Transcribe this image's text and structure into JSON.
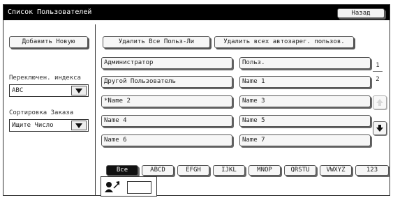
{
  "window": {
    "title": "Список Пользователей",
    "back_label": "Назад"
  },
  "left": {
    "add_new_label": "Добавить Новую",
    "index_switch_label": "Переключен. индекса",
    "index_value": "ABC",
    "sort_label": "Сортировка Заказа",
    "sort_value": "Ищите Число"
  },
  "top_actions": {
    "delete_all_label": "Удалить Все Польз-Ли",
    "delete_auto_label": "Удалить всех автозарег. пользов."
  },
  "users": [
    "Администратор",
    "Польз.",
    "Другой Пользователь",
    "Name 1",
    "*Name 2",
    "Name 3",
    "Name 4",
    "Name 5",
    "Name 6",
    "Name 7"
  ],
  "pager": {
    "current": "1",
    "total": "2"
  },
  "tabs": [
    "Все",
    "ABCD",
    "EFGH",
    "IJKL",
    "MNOP",
    "QRSTU",
    "VWXYZ",
    "123"
  ],
  "active_tab": "Все",
  "icons": {
    "user_icon": "user-arrow-icon",
    "up": "arrow-up-icon",
    "down": "arrow-down-icon",
    "dropdown": "chevron-down-icon"
  }
}
